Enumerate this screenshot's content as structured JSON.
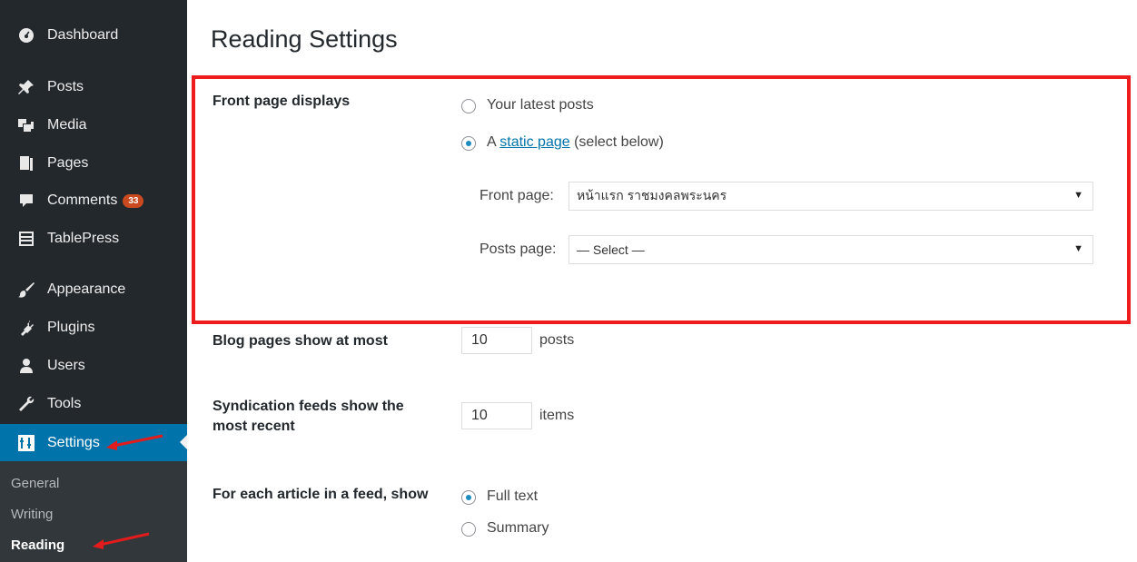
{
  "sidebar": {
    "items": [
      {
        "label": "Dashboard",
        "icon": "dashboard-icon"
      },
      {
        "label": "Posts",
        "icon": "pin-icon"
      },
      {
        "label": "Media",
        "icon": "media-icon"
      },
      {
        "label": "Pages",
        "icon": "pages-icon"
      },
      {
        "label": "Comments",
        "icon": "comment-icon",
        "badge": "33"
      },
      {
        "label": "TablePress",
        "icon": "table-icon"
      },
      {
        "label": "Appearance",
        "icon": "brush-icon"
      },
      {
        "label": "Plugins",
        "icon": "plug-icon"
      },
      {
        "label": "Users",
        "icon": "users-icon"
      },
      {
        "label": "Tools",
        "icon": "wrench-icon"
      },
      {
        "label": "Settings",
        "icon": "settings-icon",
        "active": true
      }
    ],
    "submenu": [
      {
        "label": "General"
      },
      {
        "label": "Writing"
      },
      {
        "label": "Reading",
        "current": true
      }
    ]
  },
  "main": {
    "title": "Reading Settings",
    "front_page_displays": {
      "label": "Front page displays",
      "option_latest": "Your latest posts",
      "option_static_prefix": "A",
      "option_static_link": "static page",
      "option_static_suffix": "(select below)",
      "selected": "static"
    },
    "front_page_select": {
      "label": "Front page:",
      "value": "หน้าแรก ราชมงคลพระนคร"
    },
    "posts_page_select": {
      "label": "Posts page:",
      "value": "— Select —"
    },
    "blog_pages": {
      "label": "Blog pages show at most",
      "value": "10",
      "unit": "posts"
    },
    "syndication": {
      "label": "Syndication feeds show the most recent",
      "value": "10",
      "unit": "items"
    },
    "feed_article": {
      "label": "For each article in a feed, show",
      "option_full": "Full text",
      "option_summary": "Summary",
      "selected": "full"
    }
  },
  "colors": {
    "sidebar_bg": "#23282d",
    "active_bg": "#0073aa",
    "highlight_border": "#ee1c1c",
    "badge_bg": "#ca4a1f",
    "annotation_arrow": "#e21c1c"
  }
}
